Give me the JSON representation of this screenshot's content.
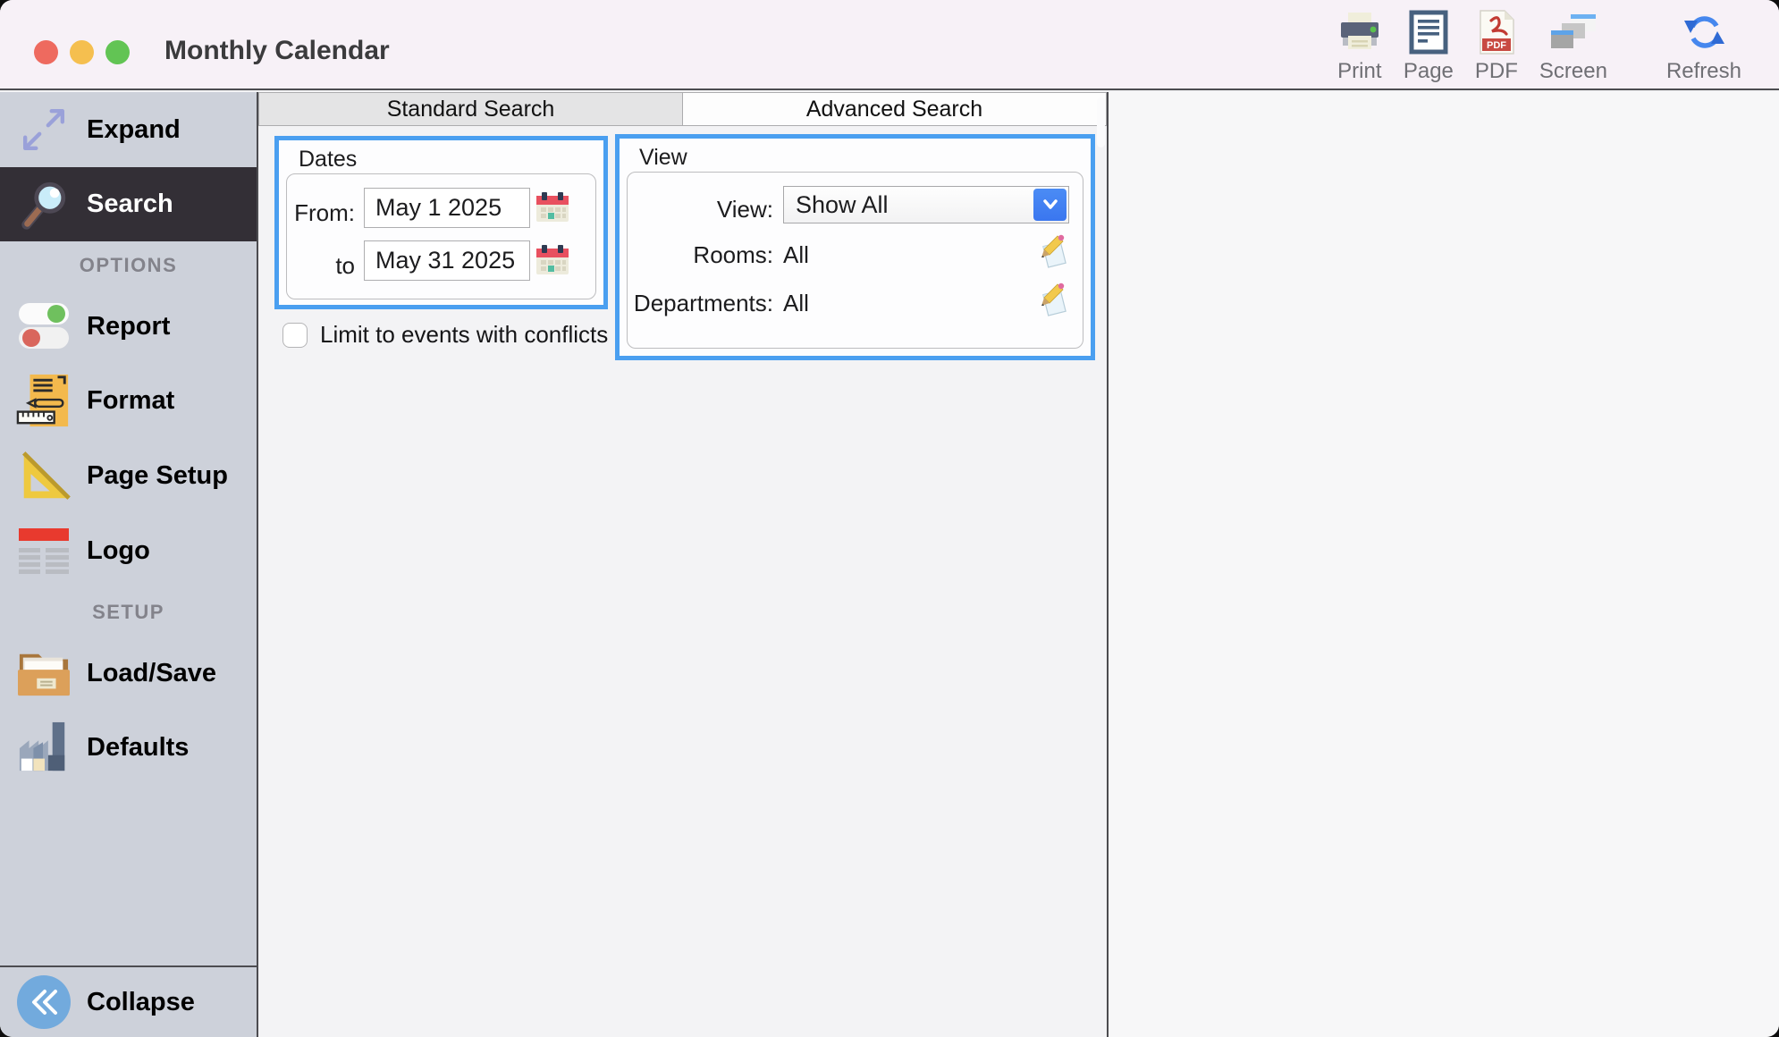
{
  "titlebar": {
    "title": "Monthly Calendar",
    "traffic_lights": {
      "close": "#ee6a5f",
      "minimize": "#f5bf4f",
      "zoom": "#62c454"
    }
  },
  "toolbar": {
    "print": {
      "label": "Print"
    },
    "page": {
      "label": "Page"
    },
    "pdf": {
      "label": "PDF",
      "badge": "PDF"
    },
    "screen": {
      "label": "Screen"
    },
    "refresh": {
      "label": "Refresh"
    }
  },
  "sidebar": {
    "expand": {
      "label": "Expand"
    },
    "search": {
      "label": "Search",
      "selected": true
    },
    "options_header": "OPTIONS",
    "report": {
      "label": "Report"
    },
    "format": {
      "label": "Format"
    },
    "page_setup": {
      "label": "Page Setup"
    },
    "logo": {
      "label": "Logo"
    },
    "setup_header": "SETUP",
    "load_save": {
      "label": "Load/Save"
    },
    "defaults": {
      "label": "Defaults"
    },
    "collapse": {
      "label": "Collapse"
    }
  },
  "tabs": {
    "standard": "Standard Search",
    "advanced": "Advanced Search",
    "active": "Advanced Search"
  },
  "form": {
    "dates": {
      "legend": "Dates",
      "from_label": "From:",
      "from_value": "May 1 2025",
      "to_label": "to",
      "to_value": "May 31 2025"
    },
    "conflicts": {
      "label": "Limit to events with conflicts",
      "checked": false
    },
    "view": {
      "legend": "View",
      "view_label": "View:",
      "view_value": "Show All",
      "rooms_label": "Rooms:",
      "rooms_value": "All",
      "departments_label": "Departments:",
      "departments_value": "All"
    }
  },
  "colors": {
    "highlight_border": "#4a9ff0",
    "dropdown_accent": "#3f7ff2",
    "titlebar_bg": "#f7f1f7",
    "sidebar_bg": "#cdd1da",
    "sidebar_selected_bg": "#332f36"
  }
}
